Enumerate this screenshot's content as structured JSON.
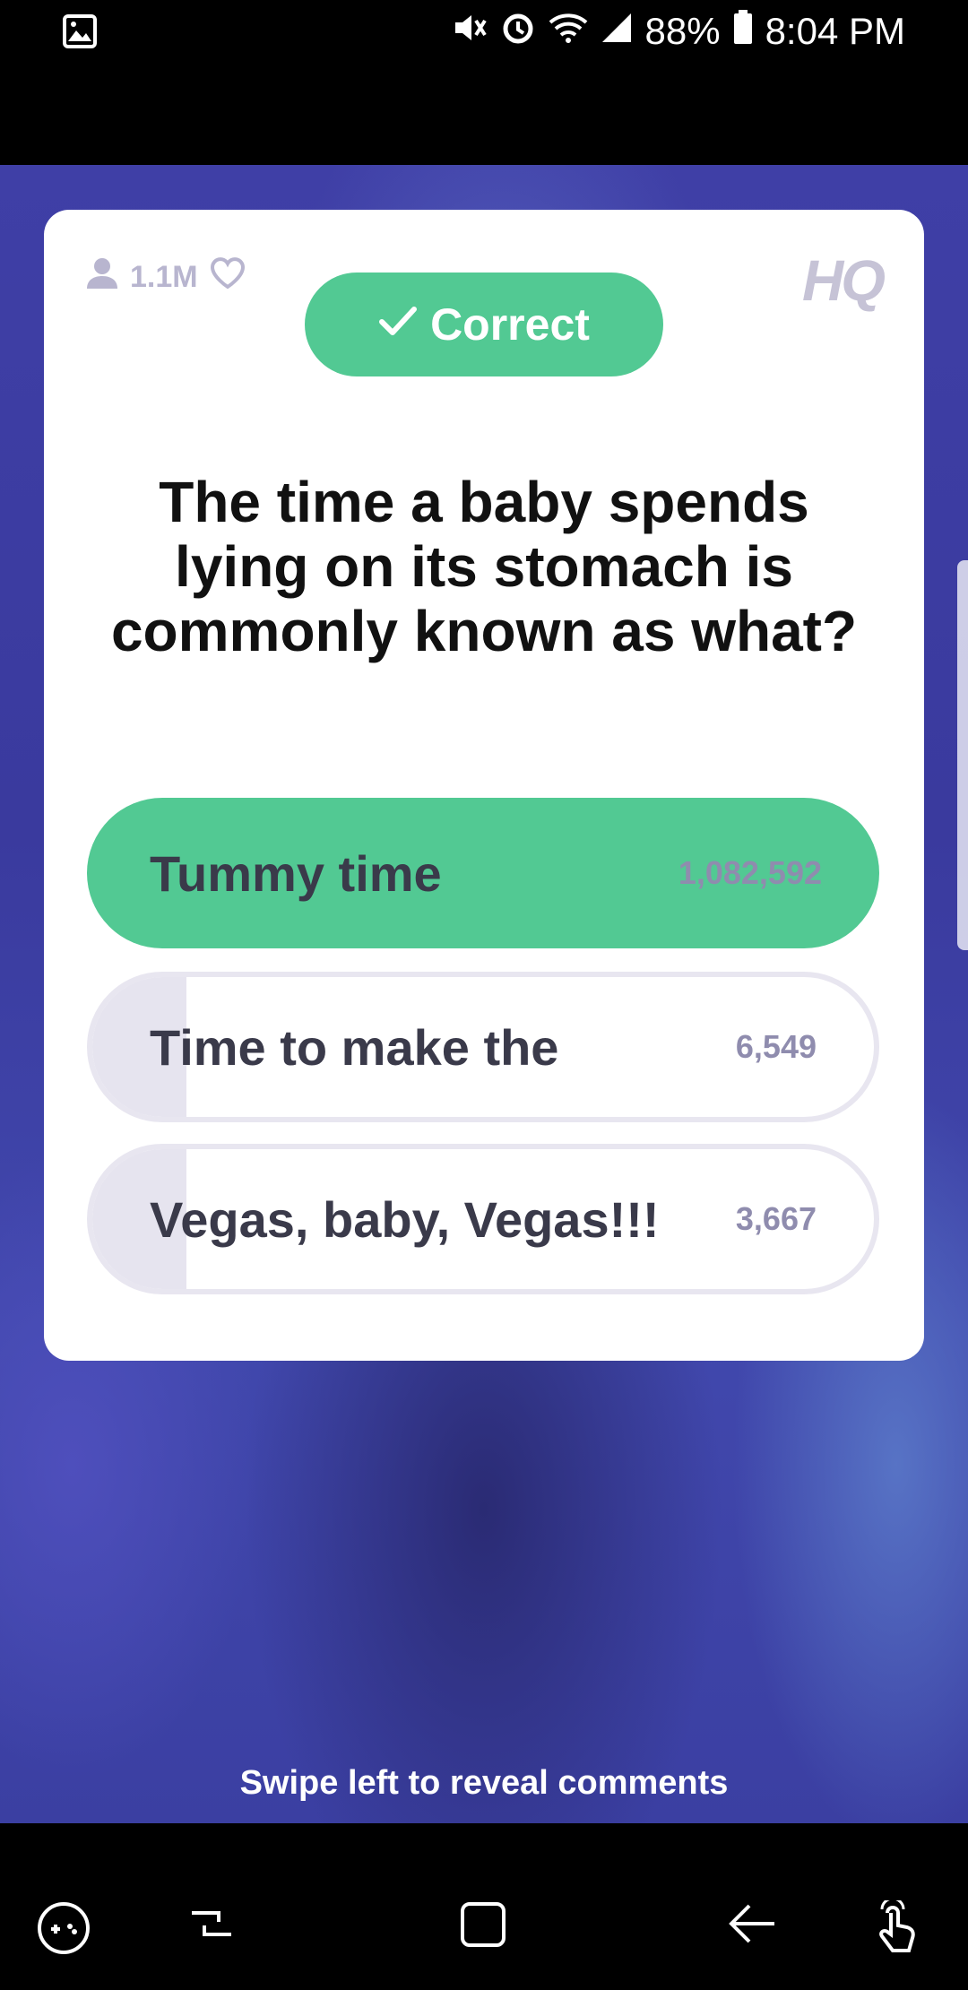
{
  "status_bar": {
    "battery": "88%",
    "time": "8:04 PM"
  },
  "card": {
    "viewers": "1.1M",
    "logo": "HQ",
    "result_label": "Correct",
    "question": "The time a baby spends lying on its stomach is commonly known as what?",
    "answers": [
      {
        "label": "Tummy time",
        "count": "1,082,592",
        "correct": true,
        "share": 1.0
      },
      {
        "label": "Time to make the",
        "count": "6,549",
        "correct": false,
        "share": 0.12
      },
      {
        "label": "Vegas, baby, Vegas!!!",
        "count": "3,667",
        "correct": false,
        "share": 0.12
      }
    ]
  },
  "swipe_hint": "Swipe left to reveal comments",
  "colors": {
    "correct_green": "#52c993",
    "background_purple": "#3f3fa6"
  },
  "icons": {
    "status_left": "image-icon",
    "nav": [
      "game-tools-icon",
      "recent-apps-icon",
      "home-icon",
      "back-icon",
      "gesture-icon"
    ]
  }
}
